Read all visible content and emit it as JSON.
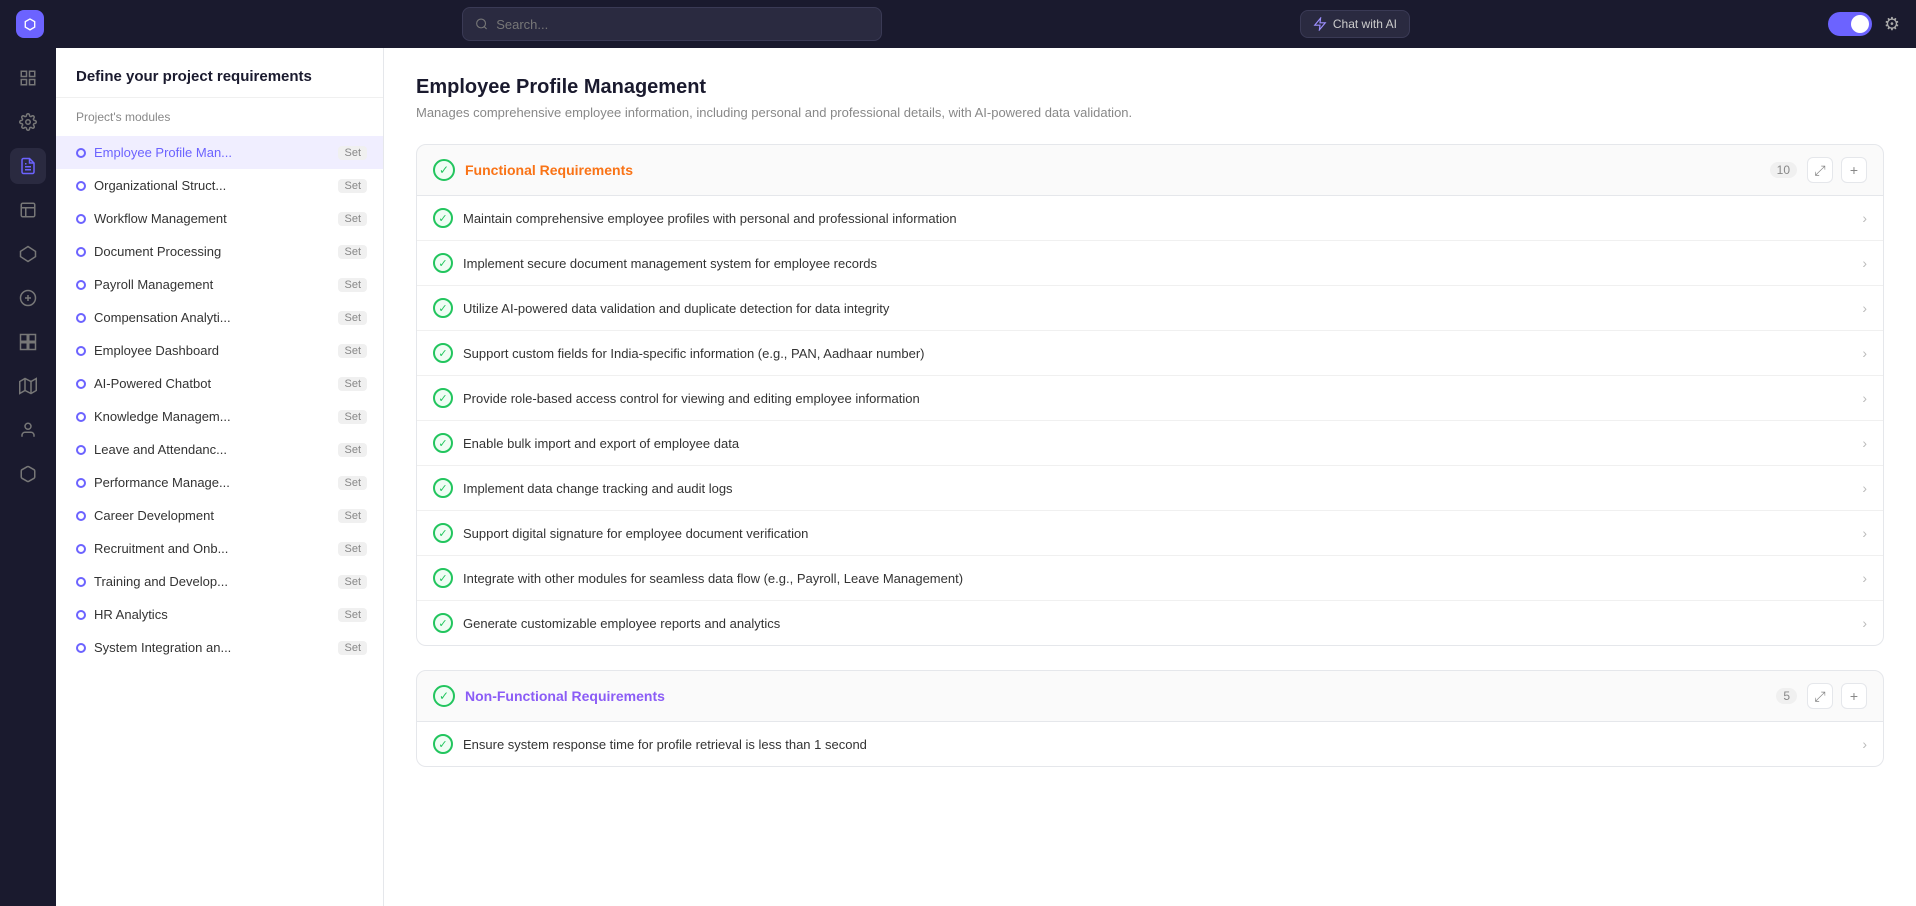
{
  "topbar": {
    "logo_text": "⬡",
    "search_placeholder": "Search...",
    "chat_ai_label": "Chat with AI",
    "settings_icon": "⚙"
  },
  "icon_sidebar": {
    "items": [
      {
        "id": "grid",
        "icon": "⊞",
        "active": false
      },
      {
        "id": "settings",
        "icon": "◎",
        "active": false
      },
      {
        "id": "document",
        "icon": "▤",
        "active": true
      },
      {
        "id": "grid2",
        "icon": "▦",
        "active": false
      },
      {
        "id": "flow",
        "icon": "⬡",
        "active": false
      },
      {
        "id": "group",
        "icon": "⊕",
        "active": false
      },
      {
        "id": "apps",
        "icon": "⊞",
        "active": false
      },
      {
        "id": "map",
        "icon": "◈",
        "active": false
      },
      {
        "id": "user",
        "icon": "👤",
        "active": false
      },
      {
        "id": "box",
        "icon": "▢",
        "active": false
      }
    ]
  },
  "project_panel": {
    "header": "Define your project requirements",
    "subtitle": "Project's modules",
    "modules": [
      {
        "name": "Employee Profile Man...",
        "badge": "Set",
        "active": true,
        "dot_color": "purple"
      },
      {
        "name": "Organizational Struct...",
        "badge": "Set",
        "active": false,
        "dot_color": "purple"
      },
      {
        "name": "Workflow Management",
        "badge": "Set",
        "active": false,
        "dot_color": "purple"
      },
      {
        "name": "Document Processing",
        "badge": "Set",
        "active": false,
        "dot_color": "purple"
      },
      {
        "name": "Payroll Management",
        "badge": "Set",
        "active": false,
        "dot_color": "purple"
      },
      {
        "name": "Compensation Analyti...",
        "badge": "Set",
        "active": false,
        "dot_color": "purple"
      },
      {
        "name": "Employee Dashboard",
        "badge": "Set",
        "active": false,
        "dot_color": "purple"
      },
      {
        "name": "AI-Powered Chatbot",
        "badge": "Set",
        "active": false,
        "dot_color": "purple"
      },
      {
        "name": "Knowledge Managem...",
        "badge": "Set",
        "active": false,
        "dot_color": "purple"
      },
      {
        "name": "Leave and Attendanc...",
        "badge": "Set",
        "active": false,
        "dot_color": "purple"
      },
      {
        "name": "Performance Manage...",
        "badge": "Set",
        "active": false,
        "dot_color": "purple"
      },
      {
        "name": "Career Development",
        "badge": "Set",
        "active": false,
        "dot_color": "purple"
      },
      {
        "name": "Recruitment and Onb...",
        "badge": "Set",
        "active": false,
        "dot_color": "purple"
      },
      {
        "name": "Training and Develop...",
        "badge": "Set",
        "active": false,
        "dot_color": "purple"
      },
      {
        "name": "HR Analytics",
        "badge": "Set",
        "active": false,
        "dot_color": "purple"
      },
      {
        "name": "System Integration an...",
        "badge": "Set",
        "active": false,
        "dot_color": "purple"
      }
    ]
  },
  "main": {
    "module_title": "Employee Profile Management",
    "module_desc": "Manages comprehensive employee information, including personal and professional details, with AI-powered data validation.",
    "sections": [
      {
        "id": "functional",
        "title": "Functional Requirements",
        "title_class": "functional",
        "count": 10,
        "items": [
          "Maintain comprehensive employee profiles with personal and professional information",
          "Implement secure document management system for employee records",
          "Utilize AI-powered data validation and duplicate detection for data integrity",
          "Support custom fields for India-specific information (e.g., PAN, Aadhaar number)",
          "Provide role-based access control for viewing and editing employee information",
          "Enable bulk import and export of employee data",
          "Implement data change tracking and audit logs",
          "Support digital signature for employee document verification",
          "Integrate with other modules for seamless data flow (e.g., Payroll, Leave Management)",
          "Generate customizable employee reports and analytics"
        ]
      },
      {
        "id": "non-functional",
        "title": "Non-Functional Requirements",
        "title_class": "non-functional",
        "count": 5,
        "items": [
          "Ensure system response time for profile retrieval is less than 1 second"
        ]
      }
    ]
  }
}
